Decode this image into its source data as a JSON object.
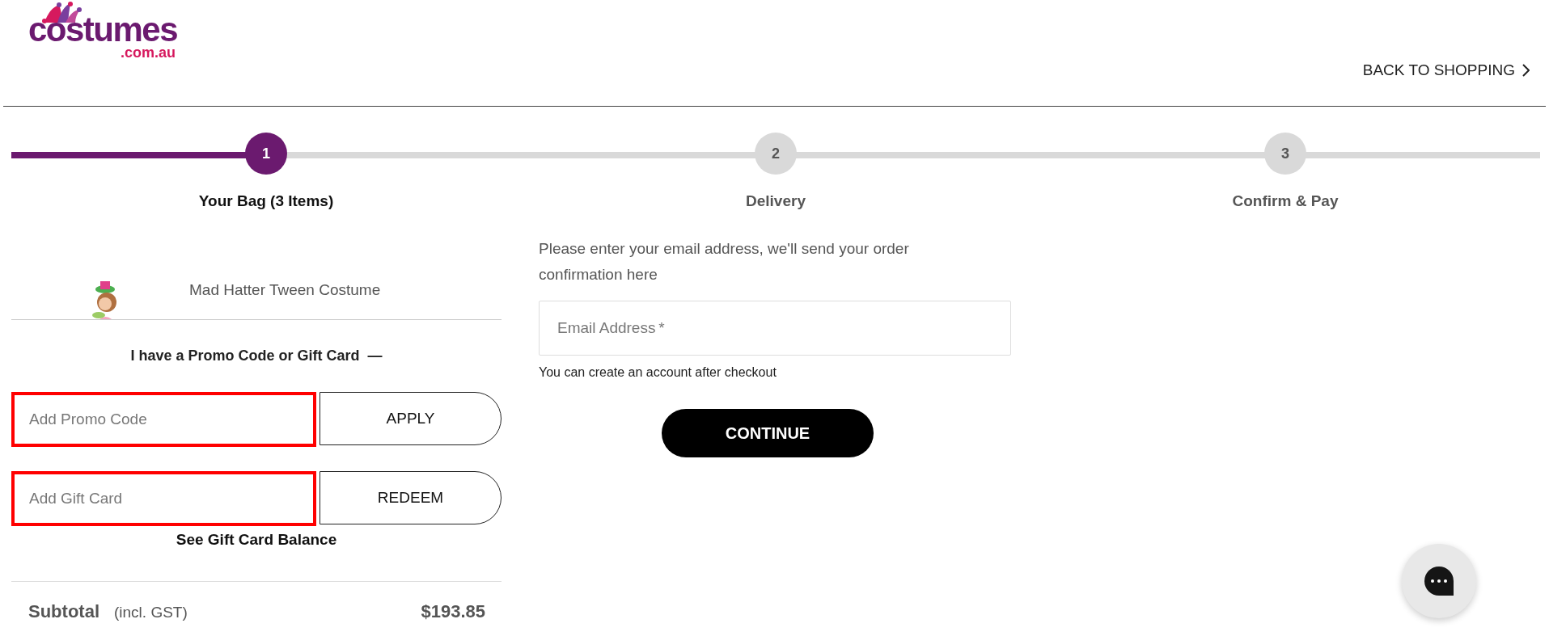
{
  "header": {
    "logo": {
      "word": "costumes",
      "domain": ".com.au"
    },
    "back_link": "BACK TO SHOPPING"
  },
  "steps": [
    {
      "number": "1",
      "label": "Your Bag (3 Items)",
      "selected": true
    },
    {
      "number": "2",
      "label": "Delivery",
      "selected": false
    },
    {
      "number": "3",
      "label": "Confirm & Pay",
      "selected": false
    }
  ],
  "bag": {
    "items": [
      {
        "name": "Mad Hatter Tween Costume"
      }
    ],
    "promo_toggle": {
      "label": "I have a Promo Code or Gift Card",
      "symbol": "—",
      "expanded": true
    },
    "codes": [
      {
        "placeholder": "Add Promo Code",
        "button": "APPLY",
        "highlighted": true
      },
      {
        "placeholder": "Add Gift Card",
        "button": "REDEEM",
        "highlighted": true
      }
    ],
    "balance_link": "See Gift Card Balance",
    "subtotal": {
      "label": "Subtotal",
      "note": "(incl. GST)",
      "amount": "$193.85"
    }
  },
  "email": {
    "intro": "Please enter your email address, we'll send your order confirmation here",
    "placeholder": "Email Address",
    "required_mark": "*",
    "helper": "You can create an account after checkout",
    "button": "CONTINUE"
  }
}
